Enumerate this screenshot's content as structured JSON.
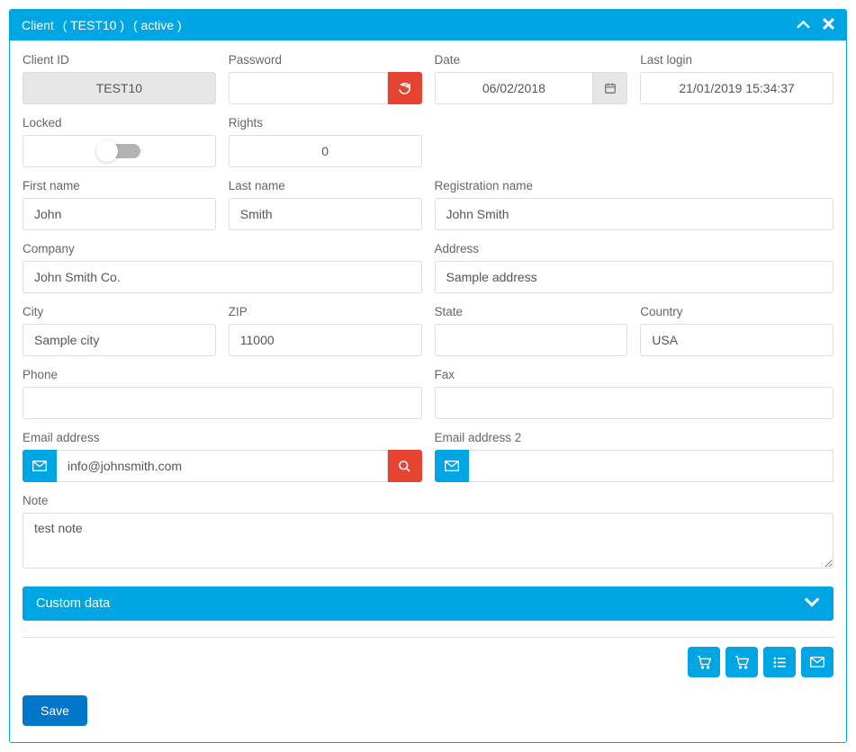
{
  "header": {
    "title": "Client",
    "code": "( TEST10 )",
    "status": "( active )"
  },
  "fields": {
    "client_id": {
      "label": "Client ID",
      "value": "TEST10"
    },
    "password": {
      "label": "Password",
      "value": ""
    },
    "date": {
      "label": "Date",
      "value": "06/02/2018"
    },
    "last_login": {
      "label": "Last login",
      "value": "21/01/2019 15:34:37"
    },
    "locked": {
      "label": "Locked",
      "value": false
    },
    "rights": {
      "label": "Rights",
      "value": "0"
    },
    "first_name": {
      "label": "First name",
      "value": "John"
    },
    "last_name": {
      "label": "Last name",
      "value": "Smith"
    },
    "reg_name": {
      "label": "Registration name",
      "value": "John Smith"
    },
    "company": {
      "label": "Company",
      "value": "John Smith Co."
    },
    "address": {
      "label": "Address",
      "value": "Sample address"
    },
    "city": {
      "label": "City",
      "value": "Sample city"
    },
    "zip": {
      "label": "ZIP",
      "value": "11000"
    },
    "state": {
      "label": "State",
      "value": ""
    },
    "country": {
      "label": "Country",
      "value": "USA"
    },
    "phone": {
      "label": "Phone",
      "value": ""
    },
    "fax": {
      "label": "Fax",
      "value": ""
    },
    "email1": {
      "label": "Email address",
      "value": "info@johnsmith.com"
    },
    "email2": {
      "label": "Email address 2",
      "value": ""
    },
    "note": {
      "label": "Note",
      "value": "test note"
    }
  },
  "sections": {
    "custom_data": "Custom data"
  },
  "buttons": {
    "save": "Save"
  }
}
